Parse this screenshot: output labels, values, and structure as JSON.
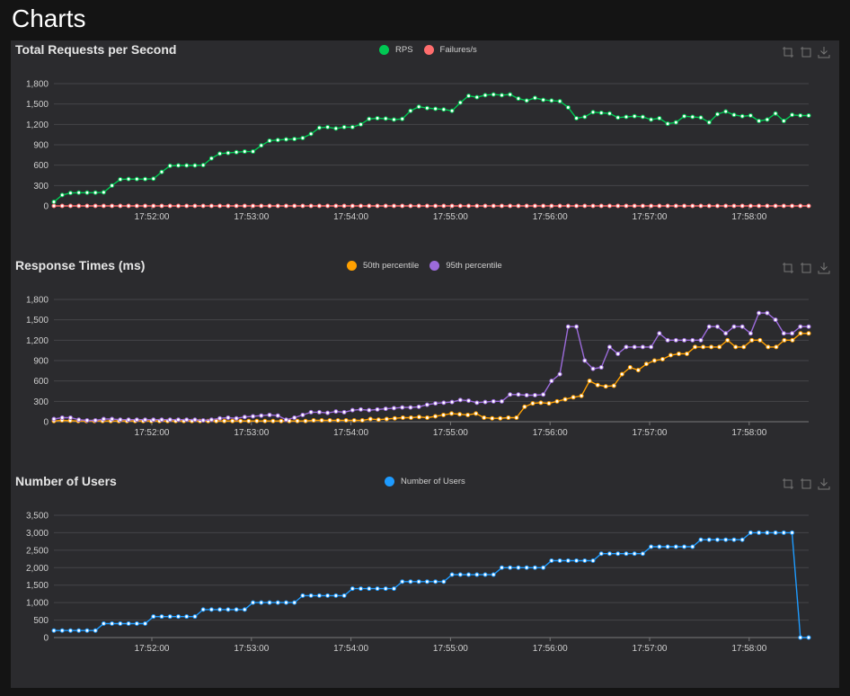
{
  "page": {
    "heading": "Charts"
  },
  "colors": {
    "rps": "#00c853",
    "failures": "#ff6d6d",
    "p50": "#ffa000",
    "p95": "#9c6bdb",
    "users": "#1e9bff"
  },
  "toolbox": {
    "icons": [
      "zoom-icon",
      "zoom-reset-icon",
      "download-icon"
    ]
  },
  "chart_data": [
    {
      "type": "line",
      "title": "Total Requests per Second",
      "x_ticks": [
        "17:52:00",
        "17:53:00",
        "17:54:00",
        "17:55:00",
        "17:56:00",
        "17:57:00",
        "17:58:00"
      ],
      "y_ticks": [
        "0",
        "300",
        "600",
        "900",
        "1,200",
        "1,500",
        "1,800"
      ],
      "ylim": [
        0,
        1800
      ],
      "legend_position": "top-center",
      "series": [
        {
          "name": "RPS",
          "color": "#00c853",
          "values": [
            60,
            160,
            190,
            195,
            195,
            195,
            200,
            300,
            390,
            395,
            395,
            395,
            400,
            500,
            590,
            595,
            595,
            595,
            600,
            700,
            770,
            780,
            790,
            800,
            800,
            890,
            960,
            970,
            980,
            985,
            1000,
            1060,
            1150,
            1160,
            1140,
            1160,
            1160,
            1200,
            1280,
            1290,
            1285,
            1270,
            1280,
            1400,
            1460,
            1440,
            1430,
            1420,
            1400,
            1520,
            1620,
            1600,
            1630,
            1640,
            1630,
            1640,
            1580,
            1550,
            1590,
            1560,
            1550,
            1540,
            1450,
            1290,
            1310,
            1380,
            1370,
            1360,
            1300,
            1310,
            1320,
            1310,
            1270,
            1290,
            1210,
            1230,
            1320,
            1310,
            1300,
            1230,
            1350,
            1390,
            1340,
            1320,
            1330,
            1250,
            1270,
            1360,
            1250,
            1340,
            1330,
            1330
          ]
        },
        {
          "name": "Failures/s",
          "color": "#ff6d6d",
          "values": [
            0,
            0,
            0,
            0,
            0,
            0,
            0,
            0,
            0,
            0,
            0,
            0,
            0,
            0,
            0,
            0,
            0,
            0,
            0,
            0,
            0,
            0,
            0,
            0,
            0,
            0,
            0,
            0,
            0,
            0,
            0,
            0,
            0,
            0,
            0,
            0,
            0,
            0,
            0,
            0,
            0,
            0,
            0,
            0,
            0,
            0,
            0,
            0,
            0,
            0,
            0,
            0,
            0,
            0,
            0,
            0,
            0,
            0,
            0,
            0,
            0,
            0,
            0,
            0,
            0,
            0,
            0,
            0,
            0,
            0,
            0,
            0,
            0,
            0,
            0,
            0,
            0,
            0,
            0,
            0,
            0,
            0,
            0,
            0,
            0,
            0,
            0,
            0,
            0,
            0,
            0,
            0
          ]
        }
      ]
    },
    {
      "type": "line",
      "title": "Response Times (ms)",
      "x_ticks": [
        "17:52:00",
        "17:53:00",
        "17:54:00",
        "17:55:00",
        "17:56:00",
        "17:57:00",
        "17:58:00"
      ],
      "y_ticks": [
        "0",
        "300",
        "600",
        "900",
        "1,200",
        "1,500",
        "1,800"
      ],
      "ylim": [
        0,
        1800
      ],
      "legend_position": "top-center",
      "series": [
        {
          "name": "50th percentile",
          "color": "#ffa000",
          "values": [
            10,
            20,
            15,
            10,
            10,
            10,
            10,
            10,
            10,
            10,
            10,
            10,
            10,
            10,
            10,
            10,
            10,
            10,
            10,
            10,
            10,
            10,
            10,
            10,
            10,
            10,
            10,
            10,
            10,
            10,
            10,
            10,
            20,
            20,
            20,
            20,
            20,
            20,
            20,
            40,
            30,
            40,
            50,
            60,
            60,
            70,
            60,
            80,
            100,
            120,
            110,
            100,
            120,
            60,
            50,
            50,
            60,
            60,
            220,
            270,
            280,
            270,
            300,
            330,
            360,
            380,
            600,
            540,
            520,
            530,
            700,
            800,
            760,
            850,
            900,
            920,
            980,
            1000,
            1000,
            1100,
            1100,
            1100,
            1100,
            1200,
            1100,
            1100,
            1200,
            1200,
            1100,
            1100,
            1200,
            1200,
            1300,
            1300
          ]
        },
        {
          "name": "95th percentile",
          "color": "#9c6bdb",
          "values": [
            40,
            60,
            60,
            30,
            20,
            20,
            40,
            40,
            30,
            30,
            30,
            30,
            30,
            30,
            30,
            30,
            30,
            30,
            20,
            30,
            50,
            60,
            50,
            70,
            80,
            90,
            100,
            90,
            30,
            60,
            100,
            140,
            140,
            130,
            150,
            140,
            170,
            180,
            170,
            180,
            190,
            200,
            210,
            210,
            220,
            250,
            270,
            280,
            290,
            320,
            310,
            280,
            290,
            300,
            300,
            400,
            400,
            390,
            390,
            400,
            600,
            700,
            1400,
            1400,
            900,
            780,
            800,
            1100,
            1000,
            1100,
            1100,
            1100,
            1100,
            1300,
            1200,
            1200,
            1200,
            1200,
            1200,
            1400,
            1400,
            1300,
            1400,
            1400,
            1300,
            1600,
            1600,
            1500,
            1300,
            1300,
            1400,
            1400
          ]
        }
      ]
    },
    {
      "type": "line",
      "title": "Number of Users",
      "x_ticks": [
        "17:52:00",
        "17:53:00",
        "17:54:00",
        "17:55:00",
        "17:56:00",
        "17:57:00",
        "17:58:00"
      ],
      "y_ticks": [
        "0",
        "500",
        "1,000",
        "1,500",
        "2,000",
        "2,500",
        "3,000",
        "3,500"
      ],
      "ylim": [
        0,
        3500
      ],
      "legend_position": "top-center",
      "series": [
        {
          "name": "Number of Users",
          "color": "#1e9bff",
          "values": [
            200,
            200,
            200,
            200,
            200,
            200,
            400,
            400,
            400,
            400,
            400,
            400,
            600,
            600,
            600,
            600,
            600,
            600,
            800,
            800,
            800,
            800,
            800,
            800,
            1000,
            1000,
            1000,
            1000,
            1000,
            1000,
            1200,
            1200,
            1200,
            1200,
            1200,
            1200,
            1400,
            1400,
            1400,
            1400,
            1400,
            1400,
            1600,
            1600,
            1600,
            1600,
            1600,
            1600,
            1800,
            1800,
            1800,
            1800,
            1800,
            1800,
            2000,
            2000,
            2000,
            2000,
            2000,
            2000,
            2200,
            2200,
            2200,
            2200,
            2200,
            2200,
            2400,
            2400,
            2400,
            2400,
            2400,
            2400,
            2600,
            2600,
            2600,
            2600,
            2600,
            2600,
            2800,
            2800,
            2800,
            2800,
            2800,
            2800,
            3000,
            3000,
            3000,
            3000,
            3000,
            3000,
            0,
            0
          ]
        }
      ]
    }
  ]
}
